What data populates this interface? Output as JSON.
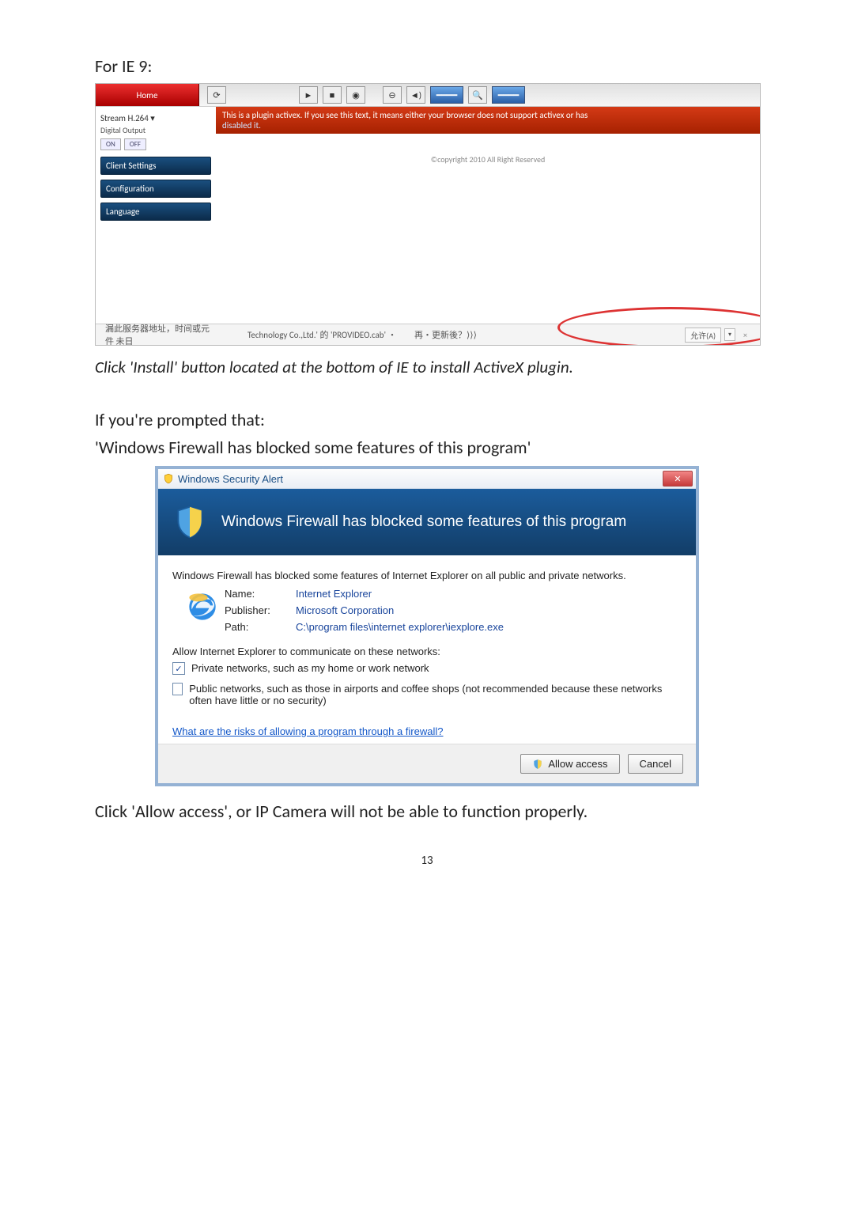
{
  "heading": "For IE 9:",
  "caption_install": "Click 'Install' button located at the bottom of IE to install ActiveX plugin.",
  "prompt_line1": "If you're prompted that:",
  "prompt_line2": "'Windows Firewall has blocked some features of this program'",
  "ie": {
    "tab": "Home",
    "icons": {
      "reload": "⟳",
      "play": "►",
      "stop": "■",
      "camera": "◉",
      "zoomout": "⊖",
      "speaker": "◄)",
      "slider": "━━━━",
      "mag": "🔍"
    },
    "banner_a": "This is a plugin activex. If you see this text, it means either your browser does not support activex or has",
    "banner_b": "disabled it.",
    "copyright": "©copyright 2010 All Right Reserved",
    "side": {
      "stream": "Stream  H.264  ▾",
      "dout": "Digital Output",
      "on": "ON",
      "off": "OFF",
      "client": "Client Settings",
      "config": "Configuration",
      "lang": "Language"
    },
    "status": {
      "left": "漏此服务器地址，时间或元件 未日",
      "center": "Technology Co.,Ltd.' 的 'PROVIDEO.cab' ・",
      "jp": "再・更新後？⟩⟩⟩",
      "pill": "允许(A)",
      "arrow": "▾",
      "x": "×"
    }
  },
  "dialog": {
    "title": "Windows Security Alert",
    "close": "✕",
    "header": "Windows Firewall has blocked some features of this program",
    "intro": "Windows Firewall has blocked some features of Internet Explorer on all public and private networks.",
    "name_l": "Name:",
    "name_v": "Internet Explorer",
    "pub_l": "Publisher:",
    "pub_v": "Microsoft Corporation",
    "path_l": "Path:",
    "path_v": "C:\\program files\\internet explorer\\iexplore.exe",
    "allow_on": "Allow Internet Explorer to communicate on these networks:",
    "private": "Private networks, such as my home or work network",
    "public": "Public networks, such as those in airports and coffee shops (not recommended because these networks often have little or no security)",
    "risk": "What are the risks of allowing a program through a firewall?",
    "btn_allow": "Allow access",
    "btn_cancel": "Cancel"
  },
  "closing": "Click 'Allow access', or IP Camera will not be able to function properly.",
  "pagenum": "13"
}
